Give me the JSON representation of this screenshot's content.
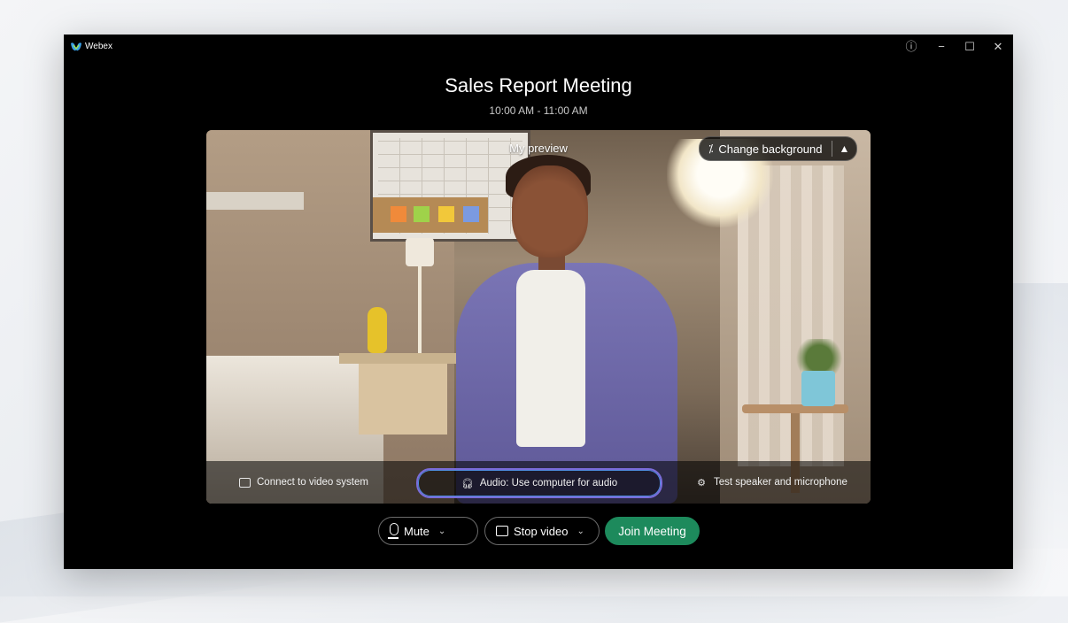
{
  "app": {
    "name": "Webex"
  },
  "window_controls": {
    "info_glyph": "ⓘ",
    "minimize_glyph": "−",
    "maximize_glyph": "☐",
    "close_glyph": "✕"
  },
  "meeting": {
    "title": "Sales Report Meeting",
    "time": "10:00 AM - 11:00 AM"
  },
  "preview": {
    "label": "My preview",
    "change_background_label": "Change background",
    "connect_label": "Connect to video system",
    "audio_label": "Audio: Use computer for audio",
    "test_label": "Test speaker and microphone"
  },
  "controls": {
    "mute_label": "Mute",
    "stop_video_label": "Stop video",
    "join_label": "Join Meeting"
  },
  "colors": {
    "join_button": "#1d8a5c",
    "audio_highlight": "#7a6cd9",
    "window_bg": "#000000"
  },
  "icons": {
    "app": "webex-logo-icon",
    "info": "info-icon",
    "change_background": "magic-wand-icon",
    "expand": "expand-icon",
    "connect": "video-system-icon",
    "audio": "headset-icon",
    "test": "gear-icon",
    "mute": "microphone-icon",
    "video": "camera-icon"
  }
}
